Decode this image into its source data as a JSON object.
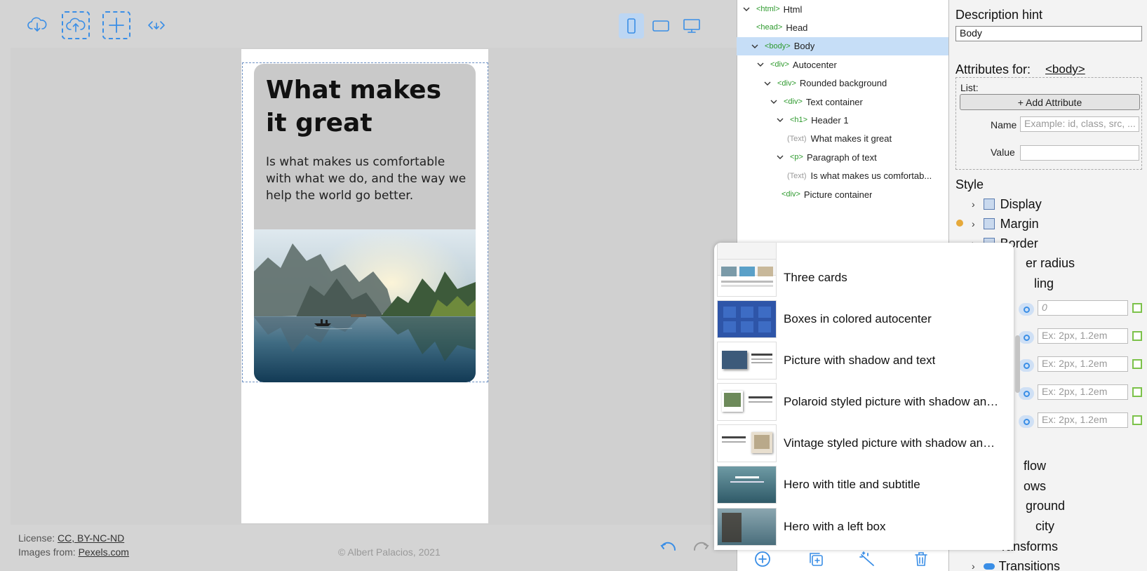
{
  "toolbar": {
    "download_icon": "cloud-download-icon",
    "upload_icon": "cloud-upload-icon",
    "add_icon": "plus-icon",
    "code_icon": "code-icon",
    "devices": [
      "mobile-icon",
      "tablet-icon",
      "desktop-icon"
    ],
    "active_device": "mobile"
  },
  "preview": {
    "heading": "What makes it great",
    "paragraph": "Is what makes us comfortable with what we do, and the way we help the world go better."
  },
  "footer": {
    "license_label": "License:",
    "license_link": "CC, BY-NC-ND",
    "images_label": "Images from:",
    "images_link": "Pexels.com",
    "copyright": "© Albert Palacios, 2021"
  },
  "tree": {
    "rows": [
      {
        "tag": "<html>",
        "name": "Html"
      },
      {
        "tag": "<head>",
        "name": "Head"
      },
      {
        "tag": "<body>",
        "name": "Body"
      },
      {
        "tag": "<div>",
        "name": "Autocenter"
      },
      {
        "tag": "<div>",
        "name": "Rounded background"
      },
      {
        "tag": "<div>",
        "name": "Text container"
      },
      {
        "tag": "<h1>",
        "name": "Header 1"
      },
      {
        "tag": "(Text)",
        "name": "What makes it great"
      },
      {
        "tag": "<p>",
        "name": "Paragraph of text"
      },
      {
        "tag": "(Text)",
        "name": "Is what makes us comfortab..."
      },
      {
        "tag": "<div>",
        "name": "Picture container"
      }
    ]
  },
  "style_panel": {
    "description_hint_label": "Description hint",
    "description_hint_value": "Body",
    "attributes_label": "Attributes for:",
    "attributes_target": "<body>",
    "list_label": "List:",
    "add_attribute": "+ Add Attribute",
    "name_label": "Name",
    "name_placeholder": "Example: id, class, src, ...",
    "value_label": "Value",
    "style_label": "Style",
    "sections": [
      "Display",
      "Margin",
      "Border",
      "er radius",
      "ling"
    ],
    "padding_first": "0",
    "padding_placeholder": "Ex: 2px, 1.2em",
    "lower_sections": [
      "flow",
      "ows",
      "ground",
      "city",
      "ransforms",
      "Transitions"
    ]
  },
  "palette": {
    "items": [
      "Three cards",
      "Boxes in colored autocenter",
      "Picture with shadow and text",
      "Polaroid styled picture with shadow and text",
      "Vintage styled picture with shadow and text",
      "Hero with title and subtitle",
      "Hero with a left box"
    ]
  },
  "bottom_bar": [
    "add-circle-icon",
    "duplicate-icon",
    "magic-wand-icon",
    "trash-icon"
  ],
  "colors": {
    "accent": "#3a8ee6",
    "tag_green": "#2e9a2e",
    "selection": "#c6def7"
  }
}
